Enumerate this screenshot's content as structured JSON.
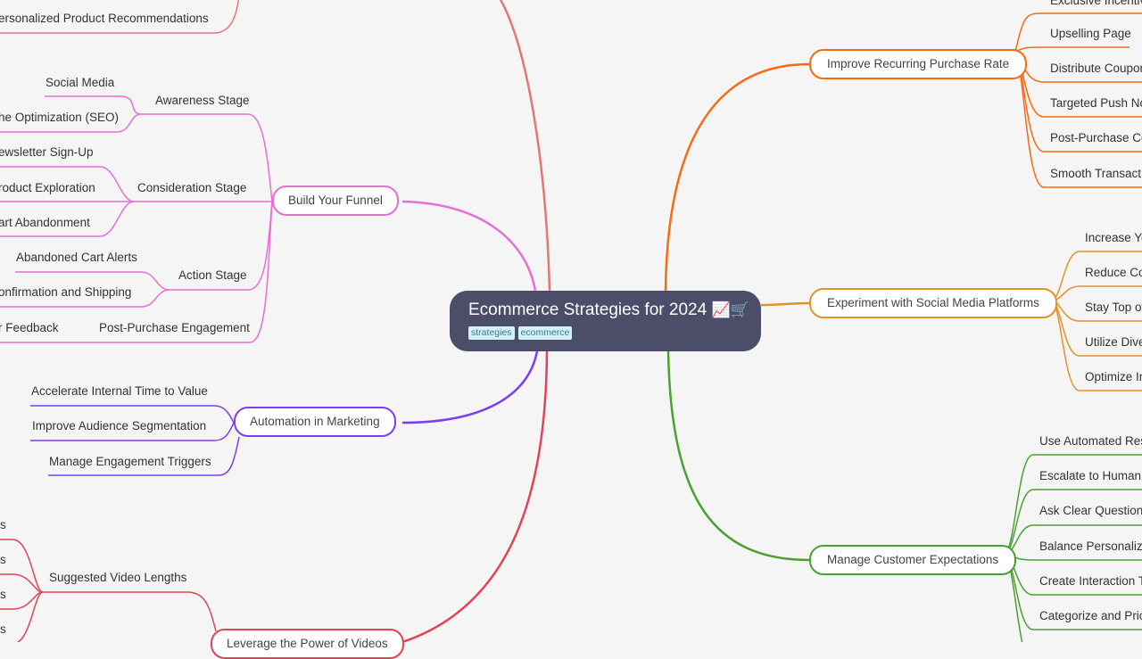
{
  "root": {
    "title": "Ecommerce Strategies for 2024",
    "emoji": "📈🛒",
    "tags": [
      "strategies",
      "ecommerce"
    ]
  },
  "branches": [
    {
      "id": "personalization",
      "color": "#e07878",
      "leaves": [
        "ersonalized Product Recommendations"
      ]
    },
    {
      "id": "funnel",
      "label": "Build Your Funnel",
      "color": "#e76fd3",
      "stages": [
        {
          "label": "Awareness Stage",
          "items": [
            "Social Media",
            "he Optimization (SEO)"
          ]
        },
        {
          "label": "Consideration Stage",
          "items": [
            "ewsletter Sign-Up",
            "roduct Exploration",
            "art Abandonment"
          ]
        },
        {
          "label": "Action Stage",
          "items": [
            "Abandoned Cart Alerts",
            "onfirmation and Shipping"
          ]
        },
        {
          "label": "Post-Purchase Engagement",
          "items": [
            "r Feedback"
          ]
        }
      ]
    },
    {
      "id": "automation",
      "label": "Automation in Marketing",
      "color": "#7a3ff0",
      "items": [
        "Accelerate Internal Time to Value",
        "Improve Audience Segmentation",
        "Manage Engagement Triggers"
      ]
    },
    {
      "id": "videos",
      "label": "Leverage the Power of Videos",
      "color": "#e04458",
      "stages": [
        {
          "label": "Suggested Video Lengths",
          "items": [
            "ls",
            "ls",
            "ls",
            "ls"
          ]
        }
      ]
    },
    {
      "id": "recurring",
      "label": "Improve Recurring Purchase Rate",
      "color": "#f76a12",
      "items": [
        "Exclusive Incentiv",
        "Upselling Page",
        "Distribute Coupon",
        "Targeted Push No",
        "Post-Purchase Co",
        "Smooth Transact"
      ]
    },
    {
      "id": "social",
      "label": "Experiment with Social Media Platforms",
      "color": "#e3922a",
      "items": [
        "Increase Yo",
        "Reduce Co",
        "Stay Top of",
        "Utilize Dive",
        "Optimize In"
      ]
    },
    {
      "id": "expectations",
      "label": "Manage Customer Expectations",
      "color": "#4aa131",
      "items": [
        "Use Automated Res",
        "Escalate to Human",
        "Ask Clear Questions",
        "Balance Personaliza",
        "Create Interaction T",
        "Categorize and Prio"
      ]
    }
  ]
}
